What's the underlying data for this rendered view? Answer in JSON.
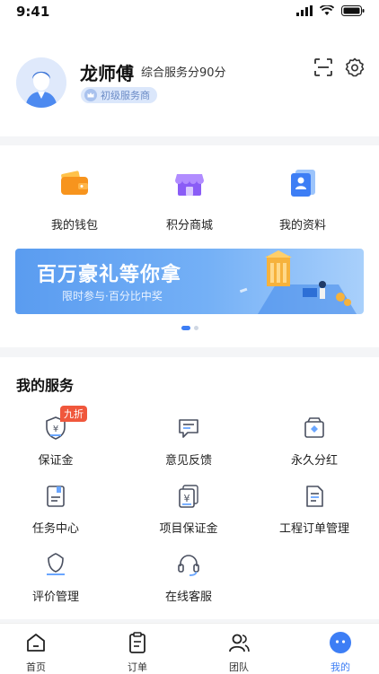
{
  "status_bar": {
    "time": "9:41"
  },
  "profile": {
    "name": "龙师傅",
    "score_text": "综合服务分90分",
    "level_badge": "初级服务商"
  },
  "quick_links": [
    {
      "label": "我的钱包",
      "icon": "wallet-icon"
    },
    {
      "label": "积分商城",
      "icon": "store-icon"
    },
    {
      "label": "我的资料",
      "icon": "profile-card-icon"
    }
  ],
  "banner": {
    "title": "百万豪礼等你拿",
    "subtitle": "限时参与·百分比中奖"
  },
  "services": {
    "title": "我的服务",
    "items": [
      {
        "label": "保证金",
        "icon": "deposit-shield-icon",
        "tag": "九折"
      },
      {
        "label": "意见反馈",
        "icon": "feedback-icon"
      },
      {
        "label": "永久分红",
        "icon": "dividend-icon"
      },
      {
        "label": "任务中心",
        "icon": "task-icon"
      },
      {
        "label": "项目保证金",
        "icon": "project-deposit-icon"
      },
      {
        "label": "工程订单管理",
        "icon": "order-doc-icon"
      },
      {
        "label": "评价管理",
        "icon": "review-icon"
      },
      {
        "label": "在线客服",
        "icon": "headset-icon"
      }
    ]
  },
  "tabbar": [
    {
      "label": "首页",
      "icon": "home-icon"
    },
    {
      "label": "订单",
      "icon": "order-clipboard-icon"
    },
    {
      "label": "团队",
      "icon": "team-icon"
    },
    {
      "label": "我的",
      "icon": "me-icon",
      "active": true
    }
  ],
  "colors": {
    "accent": "#3d7ef5",
    "tag_red": "#f0573c",
    "banner_blue": "#5a9cf0"
  }
}
